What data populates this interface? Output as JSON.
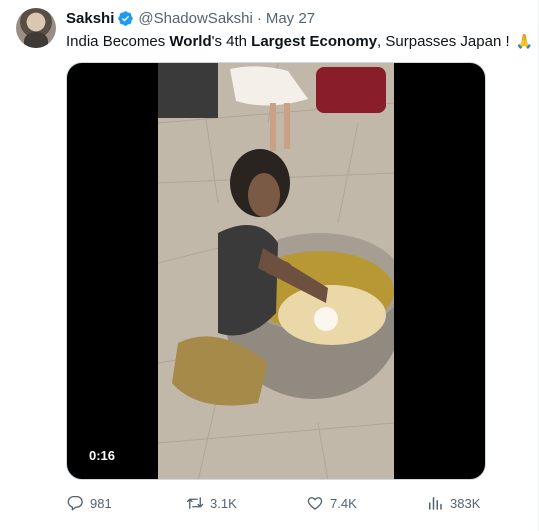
{
  "tweet": {
    "author_name": "Sakshi",
    "handle": "@ShadowSakshi",
    "separator": "·",
    "date": "May 27",
    "text_parts": [
      "India Becomes ",
      "World",
      "'s 4th ",
      "Largest Economy",
      ", Surpasses Japan ! "
    ],
    "emoji": "🙏",
    "media": {
      "duration": "0:16"
    },
    "actions": {
      "replies": "981",
      "reposts": "3.1K",
      "likes": "7.4K",
      "views": "383K"
    }
  },
  "icons": {
    "verified": "verified-badge-icon",
    "reply": "reply-icon",
    "repost": "repost-icon",
    "like": "like-icon",
    "views": "views-icon"
  },
  "colors": {
    "verified_blue": "#1d9bf0",
    "muted_text": "#536471"
  }
}
